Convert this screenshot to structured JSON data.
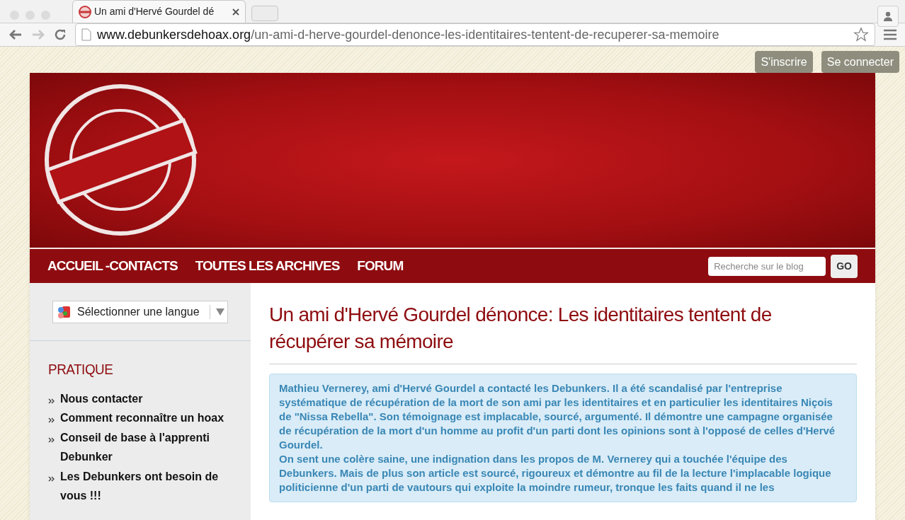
{
  "browser": {
    "tab_title": "Un ami d'Hervé Gourdel dé",
    "url_domain": "www.debunkersdehoax.org",
    "url_path": "/un-ami-d-herve-gourdel-denonce-les-identitaires-tentent-de-recuperer-sa-memoire"
  },
  "account_buttons": [
    "S'inscrire",
    "Se connecter"
  ],
  "nav": {
    "items": [
      "ACCUEIL -CONTACTS",
      "TOUTES LES ARCHIVES",
      "FORUM"
    ],
    "search": {
      "placeholder": "Recherche sur le blog"
    },
    "search_button": "GO"
  },
  "sidebar": {
    "language_select": "Sélectionner une langue",
    "section_title": "PRATIQUE",
    "links": [
      "Nous contacter",
      "Comment reconnaître un hoax",
      "Conseil de base à l'apprenti Debunker",
      "Les Debunkers ont besoin de vous !!!"
    ]
  },
  "article": {
    "title": "Un ami d'Hervé Gourdel dénonce: Les identitaires tentent de récupérer sa mémoire",
    "paragraphs": [
      "Mathieu Vernerey, ami d'Hervé Gourdel a contacté les Debunkers. Il a été scandalisé par l'entreprise systématique de récupération de la mort de son ami par les identitaires et en particulier les identitaires Niçois de \"Nissa Rebella\". Son témoignage est implacable, sourcé, argumenté. Il démontre une campagne organisée de récupération de la mort d'un homme au profit d'un parti dont les opinions sont à l'opposé de celles d'Hervé Gourdel.",
      "On sent une colère saine, une indignation dans les propos de M. Vernerey qui a touchée l'équipe des Debunkers. Mais de plus son article est sourcé, rigoureux et démontre au fil de la lecture l'implacable logique politicienne d'un parti de vautours qui exploite la moindre rumeur, tronque les faits quand il ne les"
    ]
  }
}
